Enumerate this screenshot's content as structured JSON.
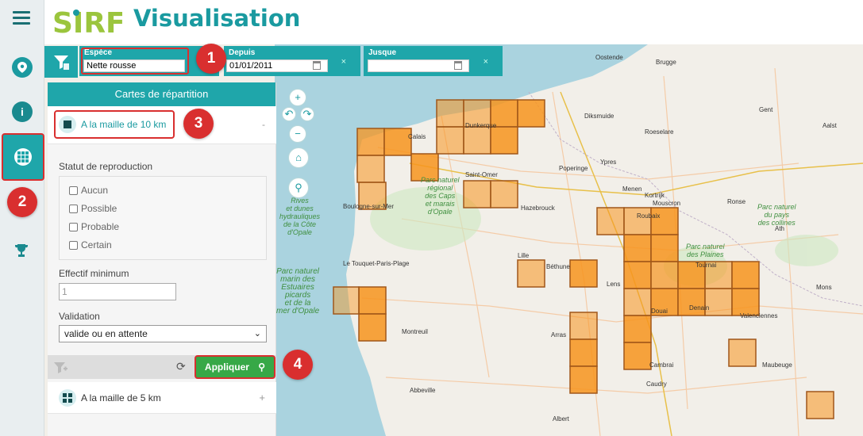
{
  "header": {
    "logo": "SIRF",
    "title": "Visualisation"
  },
  "rail": {
    "items": [
      {
        "name": "menu-icon"
      },
      {
        "name": "location-icon"
      },
      {
        "name": "info-icon"
      },
      {
        "name": "grid-icon"
      },
      {
        "name": "trophy-icon"
      }
    ]
  },
  "filters": {
    "espece_label": "Espèce",
    "espece_value": "Nette rousse",
    "depuis_label": "Depuis",
    "depuis_value": "01/01/2011",
    "jusque_label": "Jusque",
    "jusque_value": "",
    "clear": "×"
  },
  "panel": {
    "title": "Cartes de répartition",
    "maille10_label": "A la maille de 10 km",
    "maille10_toggle": "-",
    "statut_label": "Statut de reproduction",
    "statut_options": [
      "Aucun",
      "Possible",
      "Probable",
      "Certain"
    ],
    "effectif_label": "Effectif minimum",
    "effectif_placeholder": "1",
    "validation_label": "Validation",
    "validation_value": "valide ou en attente",
    "apply_label": "Appliquer",
    "maille5_label": "A la maille de 5 km",
    "maille5_toggle": "+"
  },
  "markers": [
    "1",
    "2",
    "3",
    "4"
  ],
  "map": {
    "zoom_in": "+",
    "zoom_out": "−",
    "place_labels": [
      "Oostende",
      "Brugge",
      "Gent",
      "Dunkerque",
      "Calais",
      "Boulogne-sur-Mer",
      "Lille",
      "Kortrijk",
      "Tournai",
      "Arras",
      "Valenciennes",
      "Mons",
      "Cambrai",
      "Abbeville",
      "Béthune",
      "Lens",
      "Douai",
      "Le Touquet-Paris-Plage",
      "Hazebrouck",
      "Saint-Omer",
      "Ypres",
      "Roubaix",
      "Mouscron",
      "Poperinge",
      "Diksmuide",
      "Roeselare",
      "Menen",
      "Aalst",
      "Ronse",
      "Ath",
      "Maubeuge",
      "Caudry",
      "Albert",
      "Montreuil",
      "Denain"
    ],
    "park_labels": [
      "Parc naturel\nrégional\ndes Caps\net marais\nd'Opale",
      "Parc naturel\nmarin des\nEstuaires\npicards\net de la\nmer d'Opale",
      "Parc naturel\ndes Plaines",
      "Parc naturel\ndu pays\ndes collines",
      "Rives\net dunes\nhydrauliques\nde la Côte\nd'Opale"
    ]
  },
  "colors": {
    "teal": "#1fa6aa",
    "cell_fill": "#f7941d",
    "cell_border": "#a0571a",
    "marker_red": "#d92f2f",
    "apply_green": "#37a847"
  }
}
